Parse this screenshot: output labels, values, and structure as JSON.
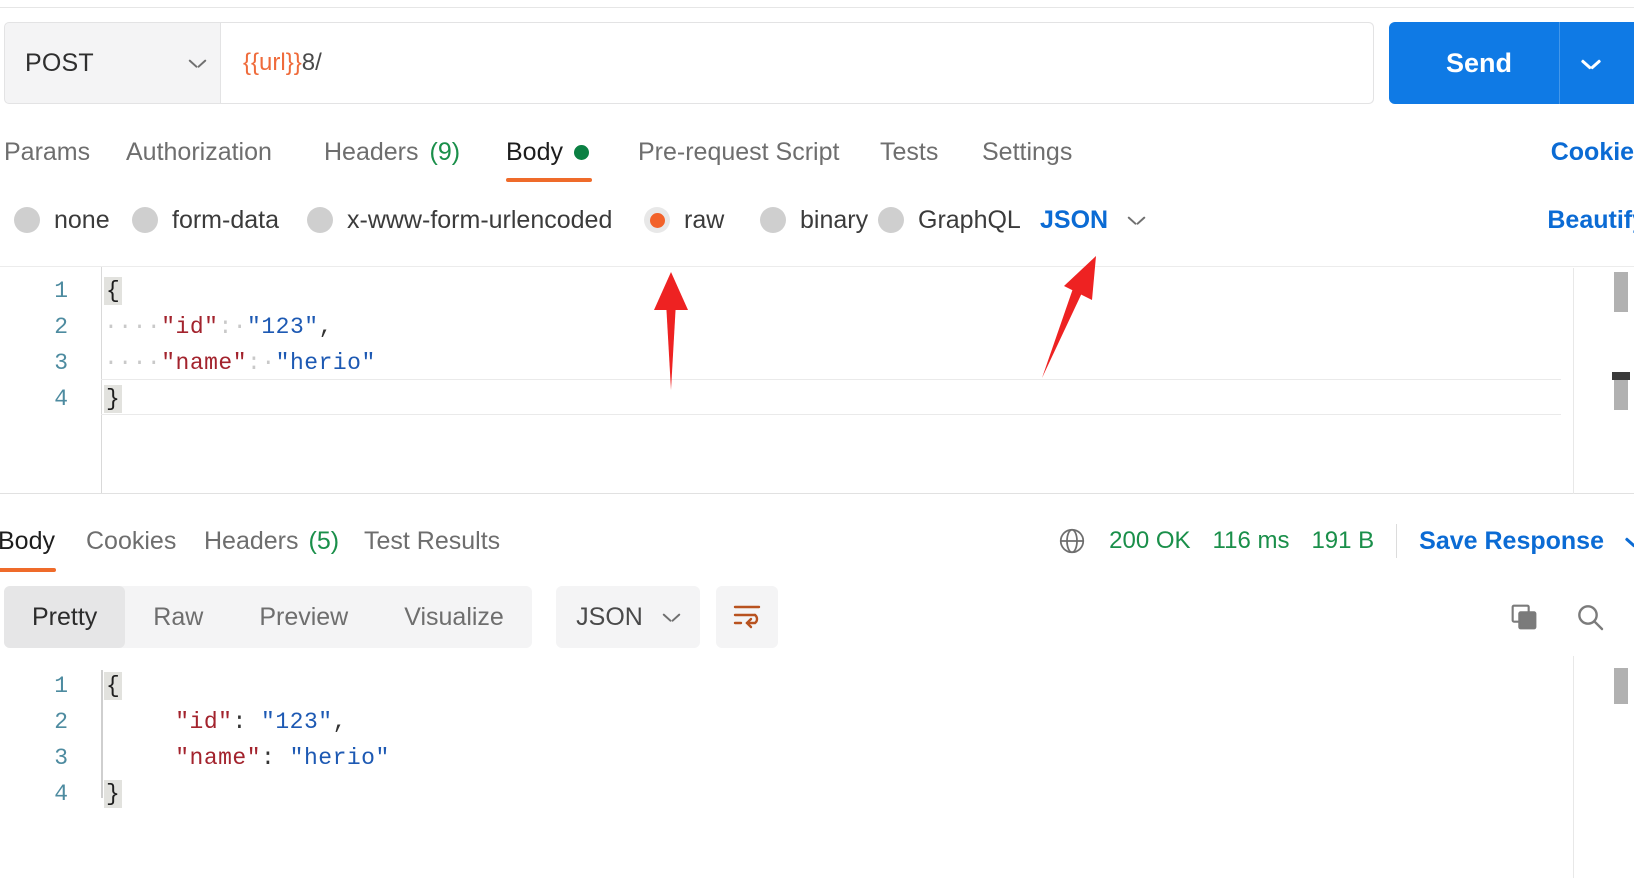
{
  "request": {
    "method": "POST",
    "url_variable": "{{url}}",
    "url_rest": "8/",
    "send_label": "Send",
    "tabs": [
      {
        "label": "Params",
        "count": "",
        "active": false
      },
      {
        "label": "Authorization",
        "count": "",
        "active": false
      },
      {
        "label": "Headers",
        "count": "(9)",
        "active": false
      },
      {
        "label": "Body",
        "count": "",
        "active": true
      },
      {
        "label": "Pre-request Script",
        "count": "",
        "active": false
      },
      {
        "label": "Tests",
        "count": "",
        "active": false
      },
      {
        "label": "Settings",
        "count": "",
        "active": false
      }
    ],
    "cookies_link": "Cookies",
    "body_types": [
      {
        "label": "none",
        "selected": false
      },
      {
        "label": "form-data",
        "selected": false
      },
      {
        "label": "x-www-form-urlencoded",
        "selected": false
      },
      {
        "label": "raw",
        "selected": true
      },
      {
        "label": "binary",
        "selected": false
      },
      {
        "label": "GraphQL",
        "selected": false
      }
    ],
    "raw_format": "JSON",
    "beautify_label": "Beautify",
    "body_lines": [
      {
        "num": "1",
        "indent": "",
        "key": "",
        "sep": "",
        "value": "",
        "brace": "{"
      },
      {
        "num": "2",
        "indent": "····",
        "key": "\"id\"",
        "sep": ":·",
        "value": "\"123\"",
        "punct": ","
      },
      {
        "num": "3",
        "indent": "····",
        "key": "\"name\"",
        "sep": ":·",
        "value": "\"herio\"",
        "punct": ""
      },
      {
        "num": "4",
        "indent": "",
        "key": "",
        "sep": "",
        "value": "",
        "brace": "}"
      }
    ]
  },
  "response": {
    "tabs": [
      {
        "label": "Body",
        "count": "",
        "active": true
      },
      {
        "label": "Cookies",
        "count": "",
        "active": false
      },
      {
        "label": "Headers",
        "count": "(5)",
        "active": false
      },
      {
        "label": "Test Results",
        "count": "",
        "active": false
      }
    ],
    "status": "200 OK",
    "time": "116 ms",
    "size": "191 B",
    "save_label": "Save Response",
    "view_modes": [
      {
        "label": "Pretty",
        "active": true
      },
      {
        "label": "Raw",
        "active": false
      },
      {
        "label": "Preview",
        "active": false
      },
      {
        "label": "Visualize",
        "active": false
      }
    ],
    "format": "JSON",
    "body_lines": [
      {
        "num": "1",
        "indent": "",
        "key": "",
        "sep": "",
        "value": "",
        "brace": "{"
      },
      {
        "num": "2",
        "indent": "    ",
        "key": "\"id\"",
        "sep": ": ",
        "value": "\"123\"",
        "punct": ","
      },
      {
        "num": "3",
        "indent": "    ",
        "key": "\"name\"",
        "sep": ": ",
        "value": "\"herio\"",
        "punct": ""
      },
      {
        "num": "4",
        "indent": "",
        "key": "",
        "sep": "",
        "value": "",
        "brace": "}"
      }
    ]
  },
  "icons": {
    "method_chevron": "chevron-down-icon",
    "send_chevron": "chevron-down-icon",
    "format_chevron": "chevron-down-icon",
    "globe": "globe-icon",
    "wrap": "wrap-lines-icon",
    "copy": "copy-icon",
    "search": "search-icon"
  },
  "annotations": [
    {
      "name": "arrow-pointing-to-raw",
      "color": "#ee2222"
    },
    {
      "name": "arrow-pointing-to-json-format",
      "color": "#ee2222"
    }
  ],
  "colors": {
    "accent_orange": "#ef6b2a",
    "link_blue": "#0b6bd4",
    "send_blue": "#0f7ae5",
    "status_green": "#1a8f4a",
    "json_key": "#a3232d",
    "json_value": "#1d59b3"
  }
}
